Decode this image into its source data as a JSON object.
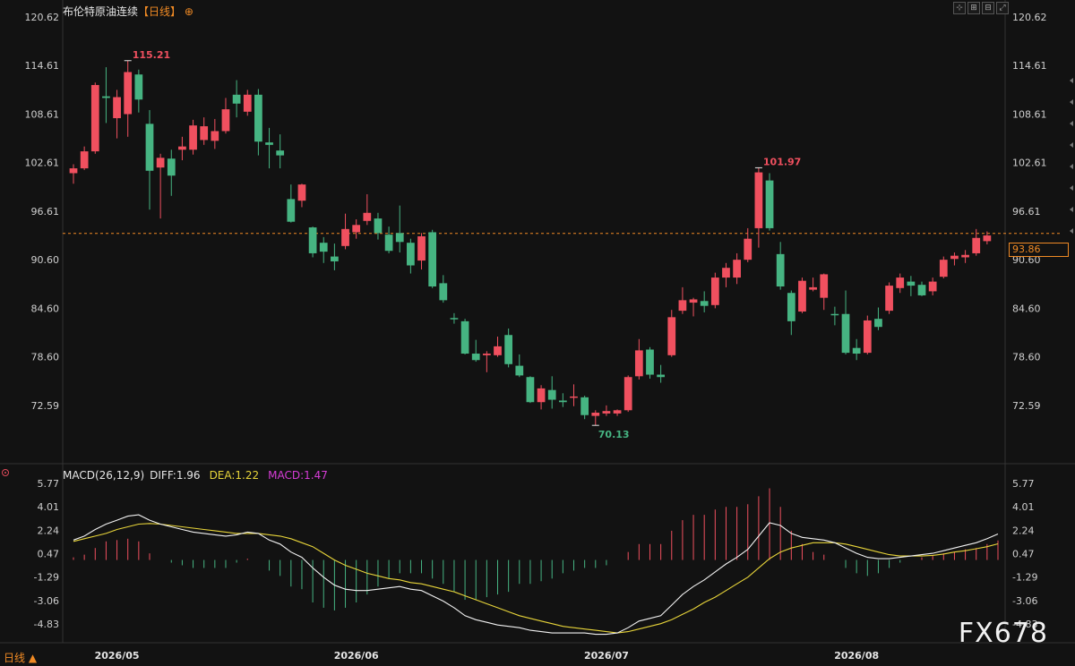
{
  "header": {
    "title": "布伦特原油连续",
    "period": "【日线】",
    "period_icon": "⊕"
  },
  "toolbar": {
    "icons": [
      "move-icon",
      "zoom-in-icon",
      "zoom-out-icon",
      "expand-icon"
    ],
    "glyphs": [
      "⊹",
      "⊞",
      "⊟",
      "⤢"
    ]
  },
  "macd": {
    "label": "MACD(26,12,9)",
    "diff_label": "DIFF:1.96",
    "dea_label": "DEA:1.22",
    "macd_label": "MACD:1.47"
  },
  "period_button": "日线 ▲",
  "watermark": "FX678",
  "current_price": "93.86",
  "colors": {
    "up": "#f0505f",
    "down": "#46b482",
    "diff": "#f2f2f2",
    "dea": "#e8d53a",
    "accent": "#f08a24",
    "grid": "#2a2a2a"
  },
  "chart_data": [
    {
      "type": "candlestick",
      "title": "布伦特原油连续",
      "y_ticks": [
        "120.62",
        "114.61",
        "108.61",
        "102.61",
        "96.61",
        "90.60",
        "84.60",
        "78.60",
        "72.59"
      ],
      "y_tick_values": [
        120.62,
        114.61,
        108.61,
        102.61,
        96.61,
        90.6,
        84.6,
        78.6,
        72.59
      ],
      "ylim": [
        66.5,
        121.6
      ],
      "x_ticks": [
        {
          "label": "2026/05",
          "index": 4
        },
        {
          "label": "2026/06",
          "index": 26
        },
        {
          "label": "2026/07",
          "index": 49
        },
        {
          "label": "2026/08",
          "index": 72
        }
      ],
      "current_price": 93.86,
      "annotations": [
        {
          "text": "115.21",
          "index": 5,
          "value": 115.21,
          "kind": "high"
        },
        {
          "text": "101.97",
          "index": 63,
          "value": 101.97,
          "kind": "high"
        },
        {
          "text": "70.13",
          "index": 48,
          "value": 70.13,
          "kind": "low"
        }
      ],
      "candles": [
        {
          "o": 101.3,
          "h": 102.4,
          "l": 100.0,
          "c": 101.9
        },
        {
          "o": 101.9,
          "h": 104.6,
          "l": 101.7,
          "c": 104.0
        },
        {
          "o": 104.0,
          "h": 112.5,
          "l": 103.7,
          "c": 112.2
        },
        {
          "o": 110.8,
          "h": 114.4,
          "l": 107.5,
          "c": 110.6
        },
        {
          "o": 108.1,
          "h": 111.6,
          "l": 105.6,
          "c": 110.7
        },
        {
          "o": 108.6,
          "h": 115.21,
          "l": 105.8,
          "c": 113.8
        },
        {
          "o": 113.5,
          "h": 114.1,
          "l": 108.8,
          "c": 110.4
        },
        {
          "o": 107.4,
          "h": 109.1,
          "l": 96.8,
          "c": 101.6
        },
        {
          "o": 102.0,
          "h": 103.7,
          "l": 95.7,
          "c": 103.2
        },
        {
          "o": 103.1,
          "h": 104.2,
          "l": 98.5,
          "c": 101.0
        },
        {
          "o": 104.2,
          "h": 105.8,
          "l": 102.9,
          "c": 104.6
        },
        {
          "o": 104.2,
          "h": 107.9,
          "l": 103.6,
          "c": 107.2
        },
        {
          "o": 105.4,
          "h": 108.2,
          "l": 104.8,
          "c": 107.1
        },
        {
          "o": 105.3,
          "h": 108.0,
          "l": 104.3,
          "c": 106.5
        },
        {
          "o": 106.5,
          "h": 110.6,
          "l": 106.2,
          "c": 109.2
        },
        {
          "o": 111.0,
          "h": 112.8,
          "l": 108.2,
          "c": 109.9
        },
        {
          "o": 108.9,
          "h": 111.6,
          "l": 108.4,
          "c": 111.0
        },
        {
          "o": 111.0,
          "h": 111.7,
          "l": 103.5,
          "c": 105.2
        },
        {
          "o": 105.1,
          "h": 106.9,
          "l": 101.9,
          "c": 104.8
        },
        {
          "o": 104.1,
          "h": 106.1,
          "l": 101.9,
          "c": 103.5
        },
        {
          "o": 98.1,
          "h": 99.9,
          "l": 95.2,
          "c": 95.3
        },
        {
          "o": 97.9,
          "h": 100.0,
          "l": 97.1,
          "c": 99.9
        },
        {
          "o": 94.6,
          "h": 94.7,
          "l": 90.9,
          "c": 91.4
        },
        {
          "o": 92.7,
          "h": 93.4,
          "l": 90.2,
          "c": 91.6
        },
        {
          "o": 91.0,
          "h": 92.6,
          "l": 89.3,
          "c": 90.4
        },
        {
          "o": 92.3,
          "h": 96.3,
          "l": 91.9,
          "c": 94.4
        },
        {
          "o": 94.0,
          "h": 95.6,
          "l": 93.2,
          "c": 94.9
        },
        {
          "o": 95.4,
          "h": 98.7,
          "l": 94.9,
          "c": 96.4
        },
        {
          "o": 95.7,
          "h": 96.4,
          "l": 93.1,
          "c": 93.9
        },
        {
          "o": 93.7,
          "h": 94.7,
          "l": 91.4,
          "c": 91.7
        },
        {
          "o": 93.9,
          "h": 97.3,
          "l": 91.5,
          "c": 92.8
        },
        {
          "o": 92.7,
          "h": 93.2,
          "l": 88.9,
          "c": 89.9
        },
        {
          "o": 90.5,
          "h": 93.9,
          "l": 89.4,
          "c": 93.5
        },
        {
          "o": 94.0,
          "h": 94.3,
          "l": 87.1,
          "c": 87.3
        },
        {
          "o": 87.7,
          "h": 88.7,
          "l": 85.3,
          "c": 85.6
        },
        {
          "o": 83.4,
          "h": 84.0,
          "l": 82.7,
          "c": 83.3
        },
        {
          "o": 83.0,
          "h": 83.3,
          "l": 78.9,
          "c": 79.0
        },
        {
          "o": 79.0,
          "h": 80.7,
          "l": 78.0,
          "c": 78.2
        },
        {
          "o": 78.8,
          "h": 79.3,
          "l": 76.7,
          "c": 79.0
        },
        {
          "o": 78.8,
          "h": 81.1,
          "l": 78.6,
          "c": 79.9
        },
        {
          "o": 81.3,
          "h": 82.1,
          "l": 77.3,
          "c": 77.7
        },
        {
          "o": 77.5,
          "h": 78.9,
          "l": 76.1,
          "c": 76.3
        },
        {
          "o": 76.1,
          "h": 76.2,
          "l": 72.9,
          "c": 73.0
        },
        {
          "o": 73.0,
          "h": 75.1,
          "l": 72.1,
          "c": 74.7
        },
        {
          "o": 74.5,
          "h": 76.2,
          "l": 72.2,
          "c": 73.3
        },
        {
          "o": 73.2,
          "h": 74.1,
          "l": 72.4,
          "c": 73.0
        },
        {
          "o": 73.6,
          "h": 75.2,
          "l": 72.5,
          "c": 73.7
        },
        {
          "o": 73.6,
          "h": 73.8,
          "l": 70.9,
          "c": 71.4
        },
        {
          "o": 71.3,
          "h": 72.0,
          "l": 70.13,
          "c": 71.7
        },
        {
          "o": 71.6,
          "h": 72.6,
          "l": 71.3,
          "c": 71.9
        },
        {
          "o": 71.6,
          "h": 72.1,
          "l": 71.3,
          "c": 72.0
        },
        {
          "o": 72.0,
          "h": 76.3,
          "l": 71.8,
          "c": 76.1
        },
        {
          "o": 76.2,
          "h": 80.8,
          "l": 75.8,
          "c": 79.4
        },
        {
          "o": 79.5,
          "h": 79.8,
          "l": 75.9,
          "c": 76.4
        },
        {
          "o": 76.4,
          "h": 77.6,
          "l": 75.4,
          "c": 76.1
        },
        {
          "o": 78.8,
          "h": 84.4,
          "l": 78.6,
          "c": 83.5
        },
        {
          "o": 84.3,
          "h": 87.2,
          "l": 83.9,
          "c": 85.6
        },
        {
          "o": 85.3,
          "h": 85.9,
          "l": 83.6,
          "c": 85.7
        },
        {
          "o": 85.5,
          "h": 86.7,
          "l": 84.1,
          "c": 84.9
        },
        {
          "o": 85.0,
          "h": 89.0,
          "l": 84.6,
          "c": 88.4
        },
        {
          "o": 88.4,
          "h": 90.2,
          "l": 87.2,
          "c": 89.6
        },
        {
          "o": 88.4,
          "h": 91.4,
          "l": 87.6,
          "c": 90.6
        },
        {
          "o": 90.6,
          "h": 94.5,
          "l": 90.3,
          "c": 93.2
        },
        {
          "o": 94.5,
          "h": 101.97,
          "l": 92.1,
          "c": 101.4
        },
        {
          "o": 100.4,
          "h": 101.3,
          "l": 94.2,
          "c": 94.5
        },
        {
          "o": 91.3,
          "h": 92.8,
          "l": 86.9,
          "c": 87.3
        },
        {
          "o": 86.5,
          "h": 86.8,
          "l": 81.3,
          "c": 83.0
        },
        {
          "o": 84.2,
          "h": 88.4,
          "l": 84.0,
          "c": 88.0
        },
        {
          "o": 86.9,
          "h": 88.4,
          "l": 86.7,
          "c": 87.2
        },
        {
          "o": 85.9,
          "h": 88.9,
          "l": 84.4,
          "c": 88.8
        },
        {
          "o": 83.9,
          "h": 84.8,
          "l": 82.5,
          "c": 83.8
        },
        {
          "o": 83.9,
          "h": 86.8,
          "l": 78.9,
          "c": 79.1
        },
        {
          "o": 79.7,
          "h": 80.8,
          "l": 78.2,
          "c": 79.0
        },
        {
          "o": 79.1,
          "h": 83.7,
          "l": 78.9,
          "c": 83.1
        },
        {
          "o": 83.3,
          "h": 84.7,
          "l": 81.9,
          "c": 82.3
        },
        {
          "o": 84.3,
          "h": 87.8,
          "l": 83.9,
          "c": 87.4
        },
        {
          "o": 87.1,
          "h": 88.9,
          "l": 86.5,
          "c": 88.4
        },
        {
          "o": 87.9,
          "h": 88.6,
          "l": 86.1,
          "c": 87.4
        },
        {
          "o": 87.5,
          "h": 87.9,
          "l": 86.1,
          "c": 86.2
        },
        {
          "o": 86.7,
          "h": 88.4,
          "l": 86.2,
          "c": 87.9
        },
        {
          "o": 88.5,
          "h": 91.0,
          "l": 88.3,
          "c": 90.6
        },
        {
          "o": 90.7,
          "h": 91.5,
          "l": 89.9,
          "c": 91.1
        },
        {
          "o": 90.9,
          "h": 91.8,
          "l": 90.2,
          "c": 91.2
        },
        {
          "o": 91.4,
          "h": 94.4,
          "l": 91.1,
          "c": 93.3
        },
        {
          "o": 92.9,
          "h": 94.1,
          "l": 92.5,
          "c": 93.6
        }
      ]
    },
    {
      "type": "macd",
      "title": "MACD(26,12,9)",
      "y_ticks": [
        "5.77",
        "4.01",
        "2.24",
        "0.47",
        "-1.29",
        "-3.06",
        "-4.83"
      ],
      "y_tick_values": [
        5.77,
        4.01,
        2.24,
        0.47,
        -1.29,
        -3.06,
        -4.83
      ],
      "ylim": [
        -6.1,
        5.77
      ],
      "diff": [
        1.5,
        1.8,
        2.3,
        2.7,
        3.0,
        3.3,
        3.4,
        3.0,
        2.7,
        2.5,
        2.3,
        2.1,
        2.0,
        1.9,
        1.8,
        1.9,
        2.1,
        2.0,
        1.5,
        1.2,
        0.6,
        0.2,
        -0.6,
        -1.3,
        -1.9,
        -2.2,
        -2.3,
        -2.3,
        -2.2,
        -2.1,
        -2.0,
        -2.2,
        -2.3,
        -2.7,
        -3.1,
        -3.6,
        -4.2,
        -4.5,
        -4.7,
        -4.9,
        -5.0,
        -5.1,
        -5.3,
        -5.4,
        -5.5,
        -5.5,
        -5.5,
        -5.5,
        -5.6,
        -5.6,
        -5.5,
        -5.1,
        -4.6,
        -4.4,
        -4.2,
        -3.4,
        -2.6,
        -2.0,
        -1.5,
        -0.9,
        -0.3,
        0.2,
        0.8,
        1.8,
        2.8,
        2.6,
        2.0,
        1.7,
        1.6,
        1.5,
        1.3,
        0.9,
        0.5,
        0.2,
        0.1,
        0.1,
        0.2,
        0.3,
        0.4,
        0.5,
        0.7,
        0.9,
        1.1,
        1.3,
        1.6,
        1.96
      ],
      "dea": [
        1.4,
        1.6,
        1.8,
        2.0,
        2.3,
        2.5,
        2.7,
        2.75,
        2.7,
        2.6,
        2.5,
        2.4,
        2.3,
        2.2,
        2.1,
        2.0,
        2.0,
        2.0,
        1.9,
        1.8,
        1.6,
        1.3,
        1.0,
        0.5,
        0.0,
        -0.4,
        -0.7,
        -1.0,
        -1.2,
        -1.4,
        -1.5,
        -1.7,
        -1.8,
        -2.0,
        -2.2,
        -2.4,
        -2.7,
        -3.0,
        -3.3,
        -3.6,
        -3.9,
        -4.2,
        -4.4,
        -4.6,
        -4.8,
        -5.0,
        -5.1,
        -5.2,
        -5.3,
        -5.4,
        -5.5,
        -5.4,
        -5.2,
        -5.0,
        -4.8,
        -4.5,
        -4.1,
        -3.7,
        -3.2,
        -2.8,
        -2.3,
        -1.8,
        -1.3,
        -0.6,
        0.1,
        0.6,
        0.9,
        1.1,
        1.3,
        1.3,
        1.3,
        1.2,
        1.0,
        0.8,
        0.6,
        0.4,
        0.3,
        0.3,
        0.3,
        0.35,
        0.45,
        0.6,
        0.7,
        0.85,
        1.0,
        1.22
      ],
      "macd": [
        0.2,
        0.4,
        0.9,
        1.4,
        1.5,
        1.6,
        1.4,
        0.5,
        0.0,
        -0.2,
        -0.4,
        -0.6,
        -0.6,
        -0.6,
        -0.6,
        -0.2,
        0.1,
        0.0,
        -0.8,
        -1.2,
        -2.0,
        -2.2,
        -3.2,
        -3.6,
        -3.8,
        -3.6,
        -3.2,
        -2.6,
        -2.0,
        -1.4,
        -1.0,
        -1.0,
        -1.0,
        -1.4,
        -1.8,
        -2.4,
        -3.0,
        -3.0,
        -2.8,
        -2.6,
        -2.4,
        -1.8,
        -1.8,
        -1.6,
        -1.4,
        -1.0,
        -0.8,
        -0.6,
        -0.6,
        -0.4,
        0.0,
        0.6,
        1.2,
        1.2,
        1.2,
        2.2,
        3.0,
        3.4,
        3.4,
        3.8,
        4.0,
        4.0,
        4.2,
        4.8,
        5.4,
        4.0,
        2.2,
        1.2,
        0.6,
        0.4,
        0.0,
        -0.6,
        -1.0,
        -1.2,
        -1.0,
        -0.6,
        -0.2,
        0.0,
        0.2,
        0.3,
        0.5,
        0.6,
        0.8,
        0.9,
        1.2,
        1.47
      ]
    }
  ]
}
